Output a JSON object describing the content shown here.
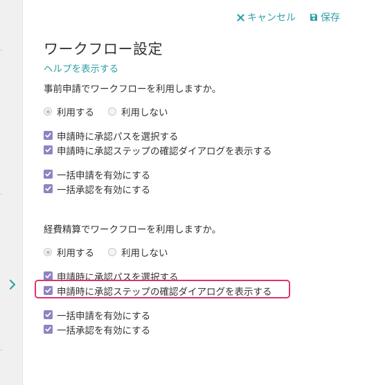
{
  "toolbar": {
    "cancel_label": "キャンセル",
    "save_label": "保存"
  },
  "title": "ワークフロー設定",
  "help_link": "ヘルプを表示する",
  "sections": [
    {
      "question": "事前申請でワークフローを利用しますか。",
      "radios": [
        {
          "label": "利用する",
          "checked": true
        },
        {
          "label": "利用しない",
          "checked": false
        }
      ],
      "group1": [
        {
          "label": "申請時に承認パスを選択する",
          "checked": true
        },
        {
          "label": "申請時に承認ステップの確認ダイアログを表示する",
          "checked": true
        }
      ],
      "group2": [
        {
          "label": "一括申請を有効にする",
          "checked": true
        },
        {
          "label": "一括承認を有効にする",
          "checked": true
        }
      ]
    },
    {
      "question": "経費精算でワークフローを利用しますか。",
      "radios": [
        {
          "label": "利用する",
          "checked": true
        },
        {
          "label": "利用しない",
          "checked": false
        }
      ],
      "group1": [
        {
          "label": "申請時に承認パスを選択する",
          "checked": true
        },
        {
          "label": "申請時に承認ステップの確認ダイアログを表示する",
          "checked": true,
          "highlighted": true
        }
      ],
      "group2": [
        {
          "label": "一括申請を有効にする",
          "checked": true
        },
        {
          "label": "一括承認を有効にする",
          "checked": true
        }
      ]
    }
  ],
  "colors": {
    "accent": "#2f9fa8",
    "checkbox": "#8d84c2",
    "highlight": "#e0316a"
  },
  "icons": {
    "cancel": "close-icon",
    "save": "floppy-disk-icon",
    "expand": "chevron-right-icon"
  }
}
